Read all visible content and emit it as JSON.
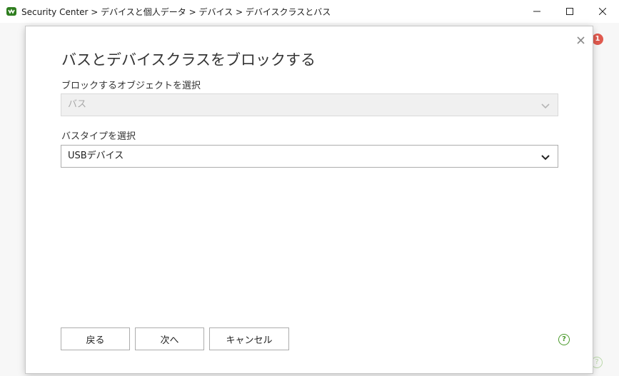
{
  "window": {
    "title": "Security Center > デバイスと個人データ > デバイス > デバイスクラスとバス",
    "icon": "shield-logo-icon",
    "badge_count": "1",
    "help_glyph": "?"
  },
  "dialog": {
    "title": "バスとデバイスクラスをブロックする",
    "object_label": "ブロックするオブジェクトを選択",
    "object_value": "バス",
    "bus_type_label": "バスタイプを選択",
    "bus_type_value": "USBデバイス",
    "buttons": {
      "back": "戻る",
      "next": "次へ",
      "cancel": "キャンセル"
    },
    "help_glyph": "?"
  },
  "colors": {
    "accent_green": "#4a9a2b",
    "badge_red": "#e05a4f"
  }
}
